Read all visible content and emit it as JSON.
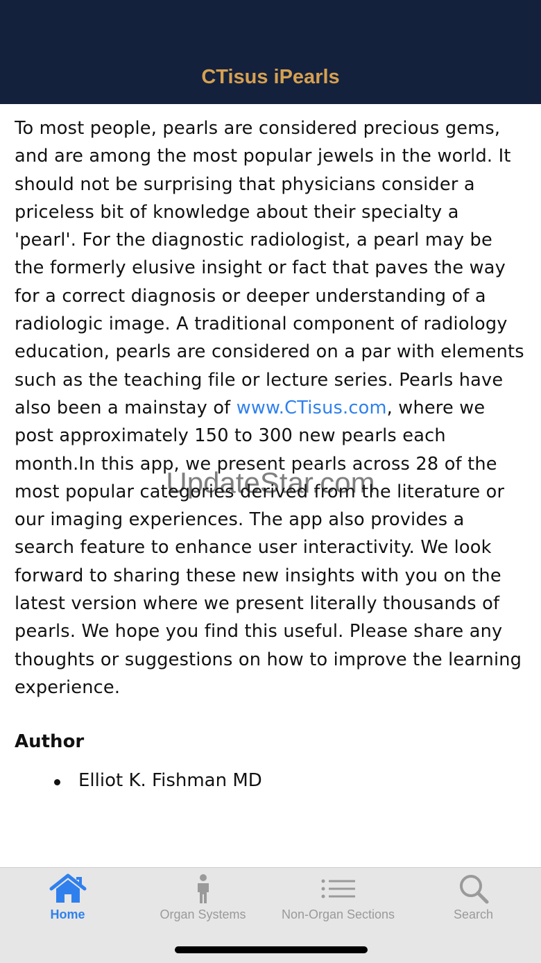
{
  "header": {
    "title": "CTisus iPearls"
  },
  "intro": {
    "before_link": "To most people, pearls are considered precious gems, and are among the most popular jewels in the world. It should not be surprising that physicians consider a priceless bit of knowledge about their specialty a 'pearl'. For the diagnostic radiologist, a pearl may be the formerly elusive insight or fact that paves the way for a correct diagnosis or deeper understanding of a radiologic image. A traditional component of radiology education, pearls are considered on a par with elements such as the teaching file or lecture series. Pearls have also been a mainstay of ",
    "link_text": "www.CTisus.com",
    "after_link": ", where we post approximately 150 to 300 new pearls each month.In this app, we present pearls across 28 of the most popular categories derived from the literature or our imaging experiences. The app also provides a search feature to enhance user interactivity. We look forward to sharing these new insights with you on the latest version where we present literally thousands of pearls. We hope you find this useful. Please share any thoughts or suggestions on how to improve the learning experience."
  },
  "author": {
    "heading": "Author",
    "items": [
      {
        "name": "Elliot K. Fishman MD"
      }
    ]
  },
  "watermark": "UpdateStar.com",
  "tabs": [
    {
      "label": "Home",
      "icon": "home-icon",
      "active": true
    },
    {
      "label": "Organ Systems",
      "icon": "person-icon",
      "active": false
    },
    {
      "label": "Non-Organ Sections",
      "icon": "list-icon",
      "active": false
    },
    {
      "label": "Search",
      "icon": "search-icon",
      "active": false
    }
  ],
  "colors": {
    "header_bg": "#14213d",
    "header_title": "#d6a150",
    "link": "#2f80ed",
    "tab_active": "#2f80ed",
    "tab_inactive": "#9a9a9a",
    "tabbar_bg": "#e6e6e6"
  }
}
